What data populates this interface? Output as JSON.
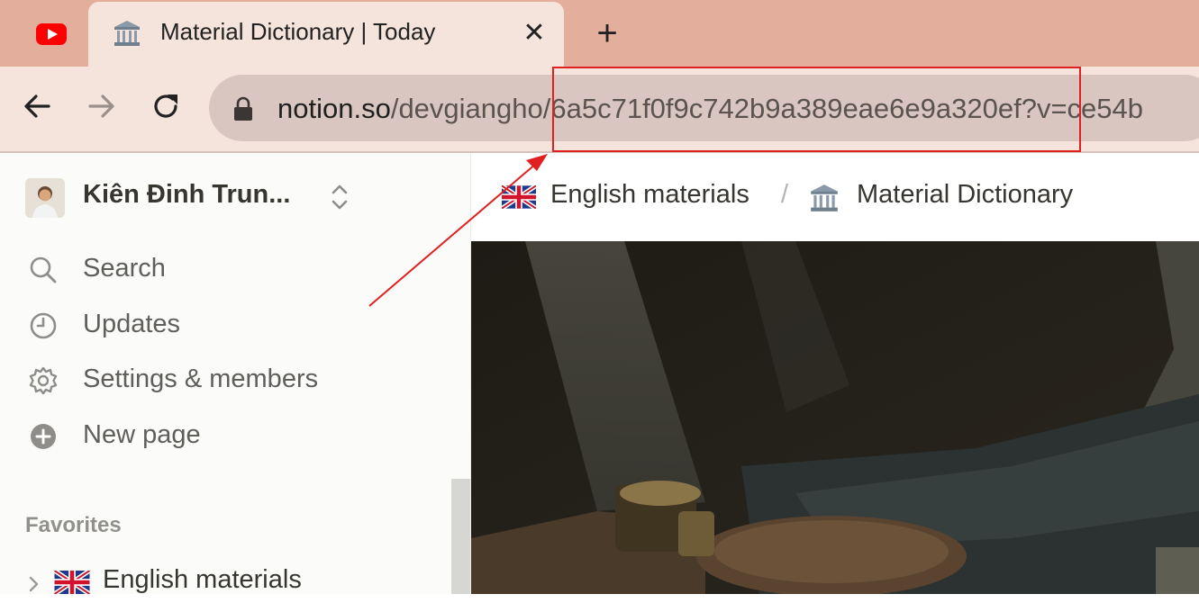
{
  "browser": {
    "tabs": [
      {
        "icon": "youtube-icon",
        "title": ""
      },
      {
        "icon": "classical-building-icon",
        "title": "Material Dictionary | Today",
        "active": true
      }
    ],
    "url_host": "notion.so",
    "url_path": "/devgiangho/6a5c71f0f9c742b9a389eae6e9a320ef?v=ce54b"
  },
  "sidebar": {
    "workspace_name": "Kiên Đinh Trun...",
    "items": [
      {
        "icon": "search-icon",
        "label": "Search"
      },
      {
        "icon": "clock-icon",
        "label": "Updates"
      },
      {
        "icon": "gear-icon",
        "label": "Settings & members"
      },
      {
        "icon": "plus-circle-icon",
        "label": "New page"
      }
    ],
    "favorites_label": "Favorites",
    "favorites": [
      {
        "icon": "uk-flag-icon",
        "label": "English materials"
      }
    ]
  },
  "breadcrumb": [
    {
      "icon": "uk-flag-icon",
      "label": "English materials"
    },
    {
      "icon": "classical-building-icon",
      "label": "Material Dictionary"
    }
  ],
  "breadcrumb_separator": "/",
  "colors": {
    "tabstrip": "#e4ae9d",
    "toolbar": "#f5e4dc",
    "annotation": "#e02020"
  }
}
